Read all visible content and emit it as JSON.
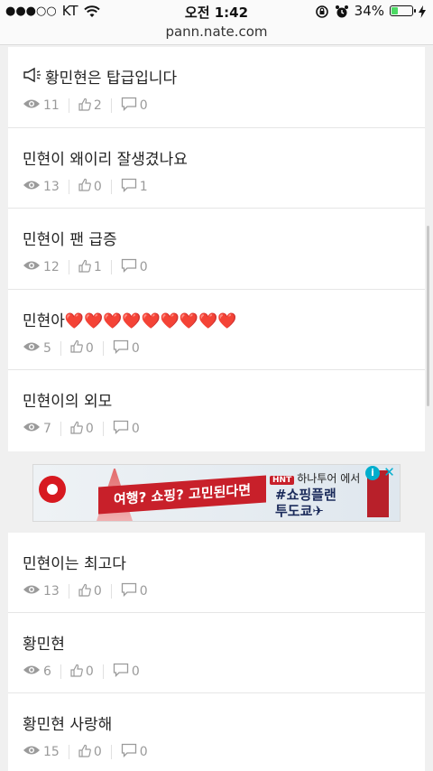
{
  "status_bar": {
    "signal": "●●●○○",
    "carrier": "KT",
    "time": "오전 1:42",
    "battery_percent": "34%",
    "battery_level": 0.34
  },
  "url": "pann.nate.com",
  "posts_top": [
    {
      "title": "황민현은 탑급입니다",
      "views": "11",
      "likes": "2",
      "comments": "0",
      "has_notice_icon": true
    },
    {
      "title": "민현이 왜이리 잘생겼나요",
      "views": "13",
      "likes": "0",
      "comments": "1"
    },
    {
      "title": "민현이 팬 급증",
      "views": "12",
      "likes": "1",
      "comments": "0"
    },
    {
      "title": "민현아❤️❤️❤️❤️❤️❤️❤️❤️❤️",
      "views": "5",
      "likes": "0",
      "comments": "0"
    },
    {
      "title": "민현이의 외모",
      "views": "7",
      "likes": "0",
      "comments": "0"
    }
  ],
  "ad": {
    "banner_text": "여행? 쇼핑? 고민된다면",
    "brand_tag": "HNT",
    "brand": "하나투어 에서",
    "line1": "#쇼핑플랜",
    "line2": "투도쿄✈",
    "info_label": "i",
    "close_label": "✕"
  },
  "posts_bottom": [
    {
      "title": "민현이는 최고다",
      "views": "13",
      "likes": "0",
      "comments": "0"
    },
    {
      "title": "황민현",
      "views": "6",
      "likes": "0",
      "comments": "0"
    },
    {
      "title": "황민현 사랑해",
      "views": "15",
      "likes": "0",
      "comments": "0"
    }
  ],
  "icons": {
    "views": "eye-icon",
    "likes": "thumbs-up-icon",
    "comments": "comment-icon",
    "notice": "megaphone-icon"
  },
  "colors": {
    "meta_text": "#9a9a9a",
    "ad_red": "#c8202a",
    "ad_close": "#00aecd"
  }
}
